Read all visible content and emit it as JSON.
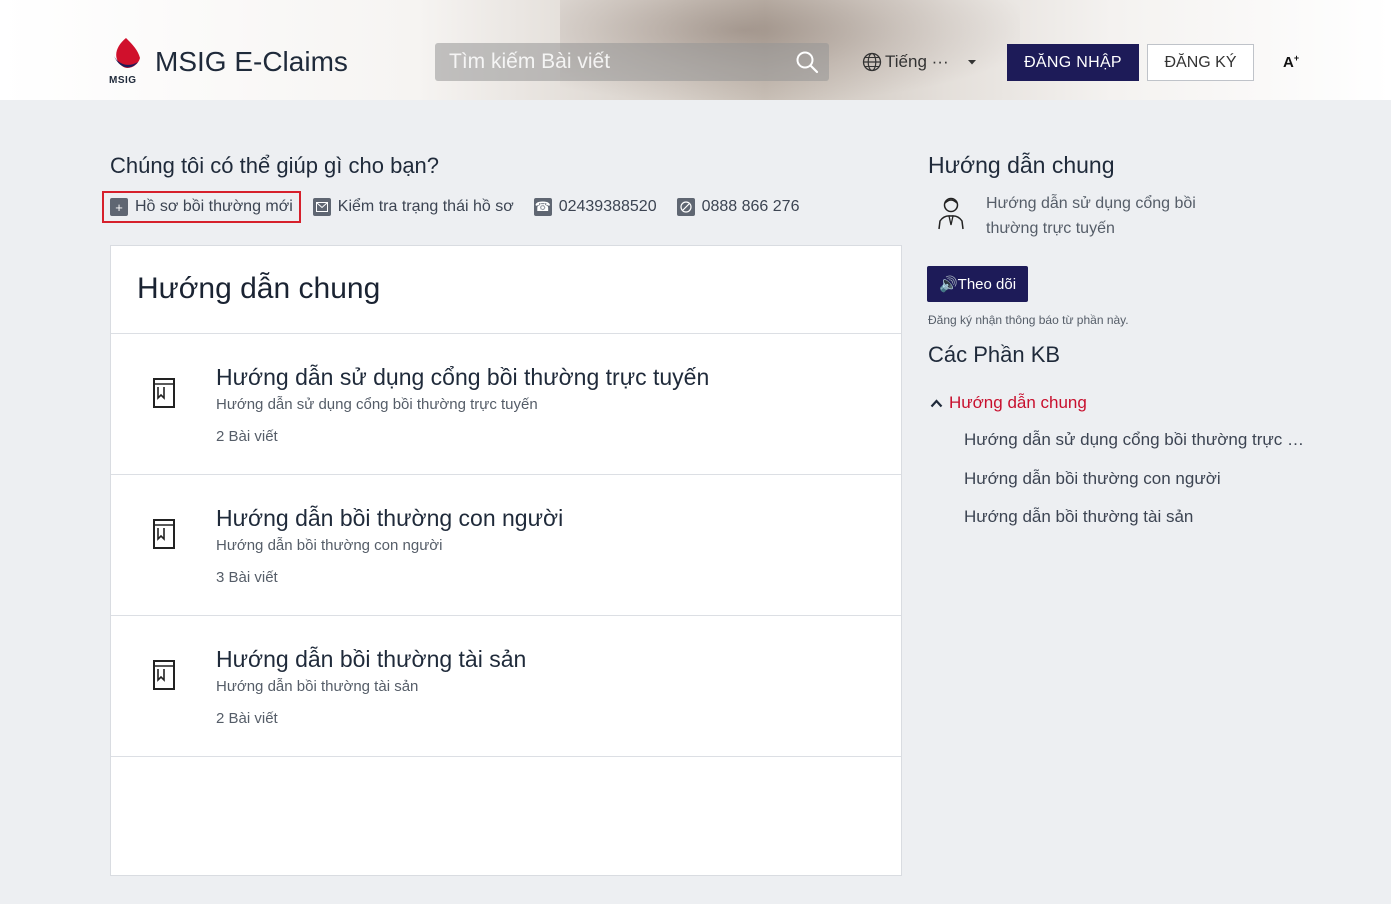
{
  "header": {
    "logo_text": "MSIG",
    "app_title": "MSIG E-Claims",
    "search_placeholder": "Tìm kiếm Bài viết",
    "language_label": "Tiếng ···",
    "login_label": "ĐĂNG NHẬP",
    "register_label": "ĐĂNG KÝ",
    "font_size_label": "A"
  },
  "help": {
    "title": "Chúng tôi có thể giúp gì cho bạn?",
    "quick_links": [
      {
        "label": "Hồ sơ bồi thường mới",
        "icon": "plus-icon"
      },
      {
        "label": "Kiểm tra trạng thái hồ sơ",
        "icon": "mail-icon"
      },
      {
        "label": "02439388520",
        "icon": "phone-icon"
      },
      {
        "label": "0888 866 276",
        "icon": "mobile-icon"
      }
    ]
  },
  "main": {
    "title": "Hướng dẫn chung",
    "sections": [
      {
        "title": "Hướng dẫn sử dụng cổng bồi thường trực tuyến",
        "description": "Hướng dẫn sử dụng cổng bồi thường trực tuyến",
        "count": "2 Bài viết"
      },
      {
        "title": "Hướng dẫn bồi thường con người",
        "description": "Hướng dẫn bồi thường con người",
        "count": "3 Bài viết"
      },
      {
        "title": "Hướng dẫn bồi thường tài sản",
        "description": "Hướng dẫn bồi thường tài sản",
        "count": "2 Bài viết"
      }
    ]
  },
  "sidebar": {
    "title": "Hướng dẫn chung",
    "description": "Hướng dẫn sử dụng cổng bồi thường trực tuyến",
    "follow_label": "Theo dõi",
    "follow_note": "Đăng ký nhận thông báo từ phần này.",
    "kb_title": "Các Phần KB",
    "kb_current": "Hướng dẫn chung",
    "kb_items": [
      "Hướng dẫn sử dụng cổng bồi thường trực tuyến",
      "Hướng dẫn bồi thường con người",
      "Hướng dẫn bồi thường tài sản"
    ]
  },
  "colors": {
    "primary": "#1d1b58",
    "accent_red": "#c8102e",
    "highlight_border": "#d6202c",
    "background": "#edeff2"
  }
}
